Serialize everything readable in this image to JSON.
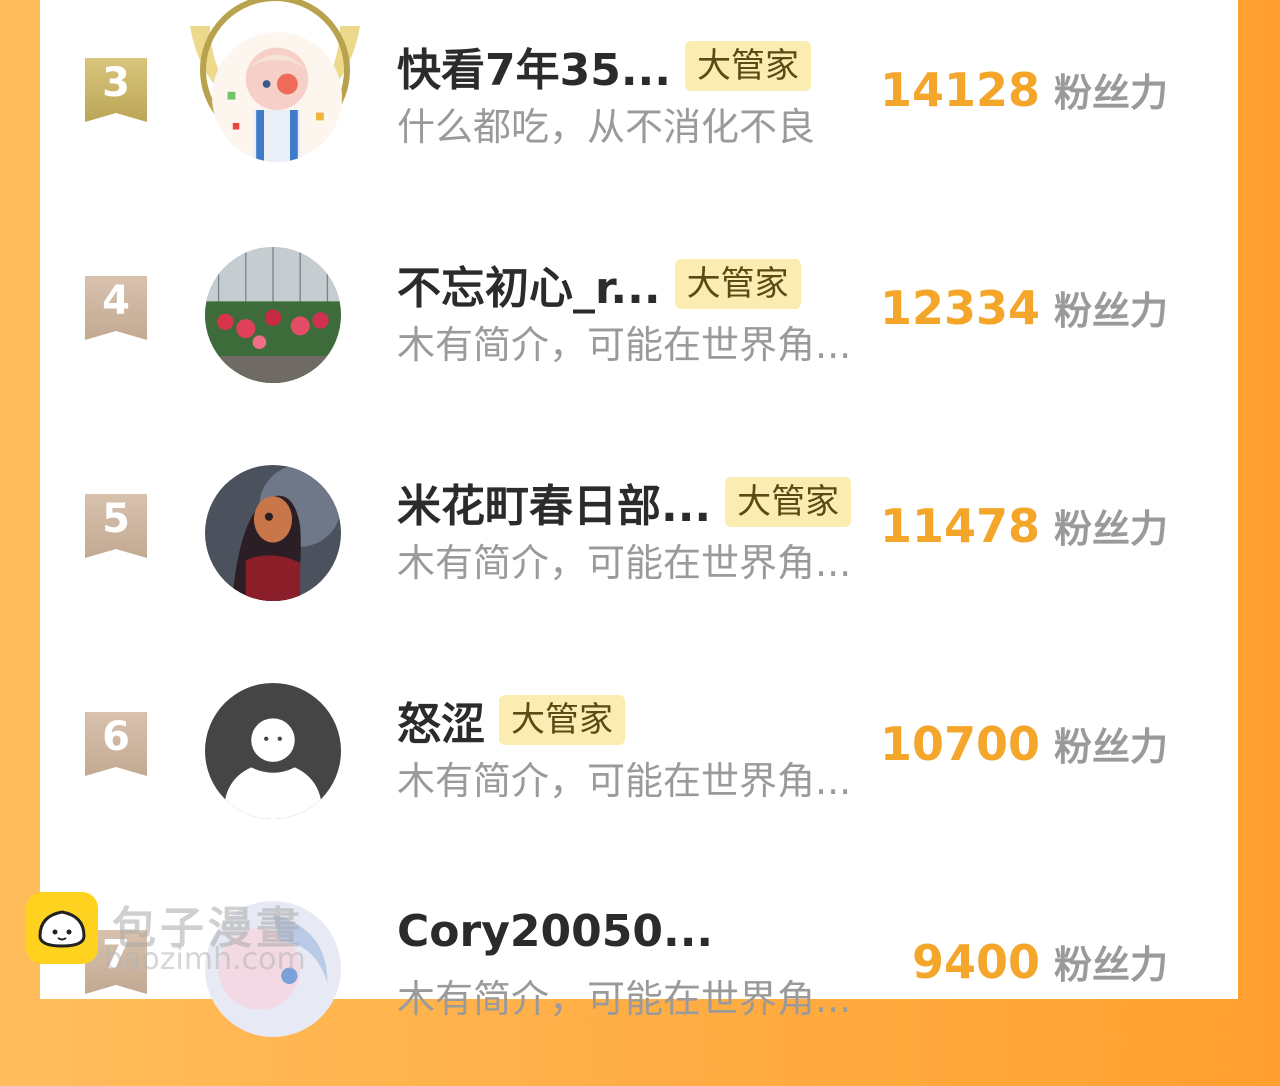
{
  "unit_label": "粉丝力",
  "rows": [
    {
      "rank": "3",
      "name": "快看7年35...",
      "badge": "大管家",
      "bio": "什么都吃，从不消化不良",
      "score": "14128"
    },
    {
      "rank": "4",
      "name": "不忘初心_r...",
      "badge": "大管家",
      "bio": "木有简介，可能在世界角...",
      "score": "12334"
    },
    {
      "rank": "5",
      "name": "米花町春日部...",
      "badge": "大管家",
      "bio": "木有简介，可能在世界角...",
      "score": "11478"
    },
    {
      "rank": "6",
      "name": "怒涩",
      "badge": "大管家",
      "bio": "木有简介，可能在世界角...",
      "score": "10700"
    },
    {
      "rank": "7",
      "name": "Cory20050...",
      "badge": "",
      "bio": "木有简介，可能在世界角...",
      "score": "9400"
    }
  ],
  "watermark": {
    "title": "包子漫畫",
    "sub": "baozimh.com"
  }
}
